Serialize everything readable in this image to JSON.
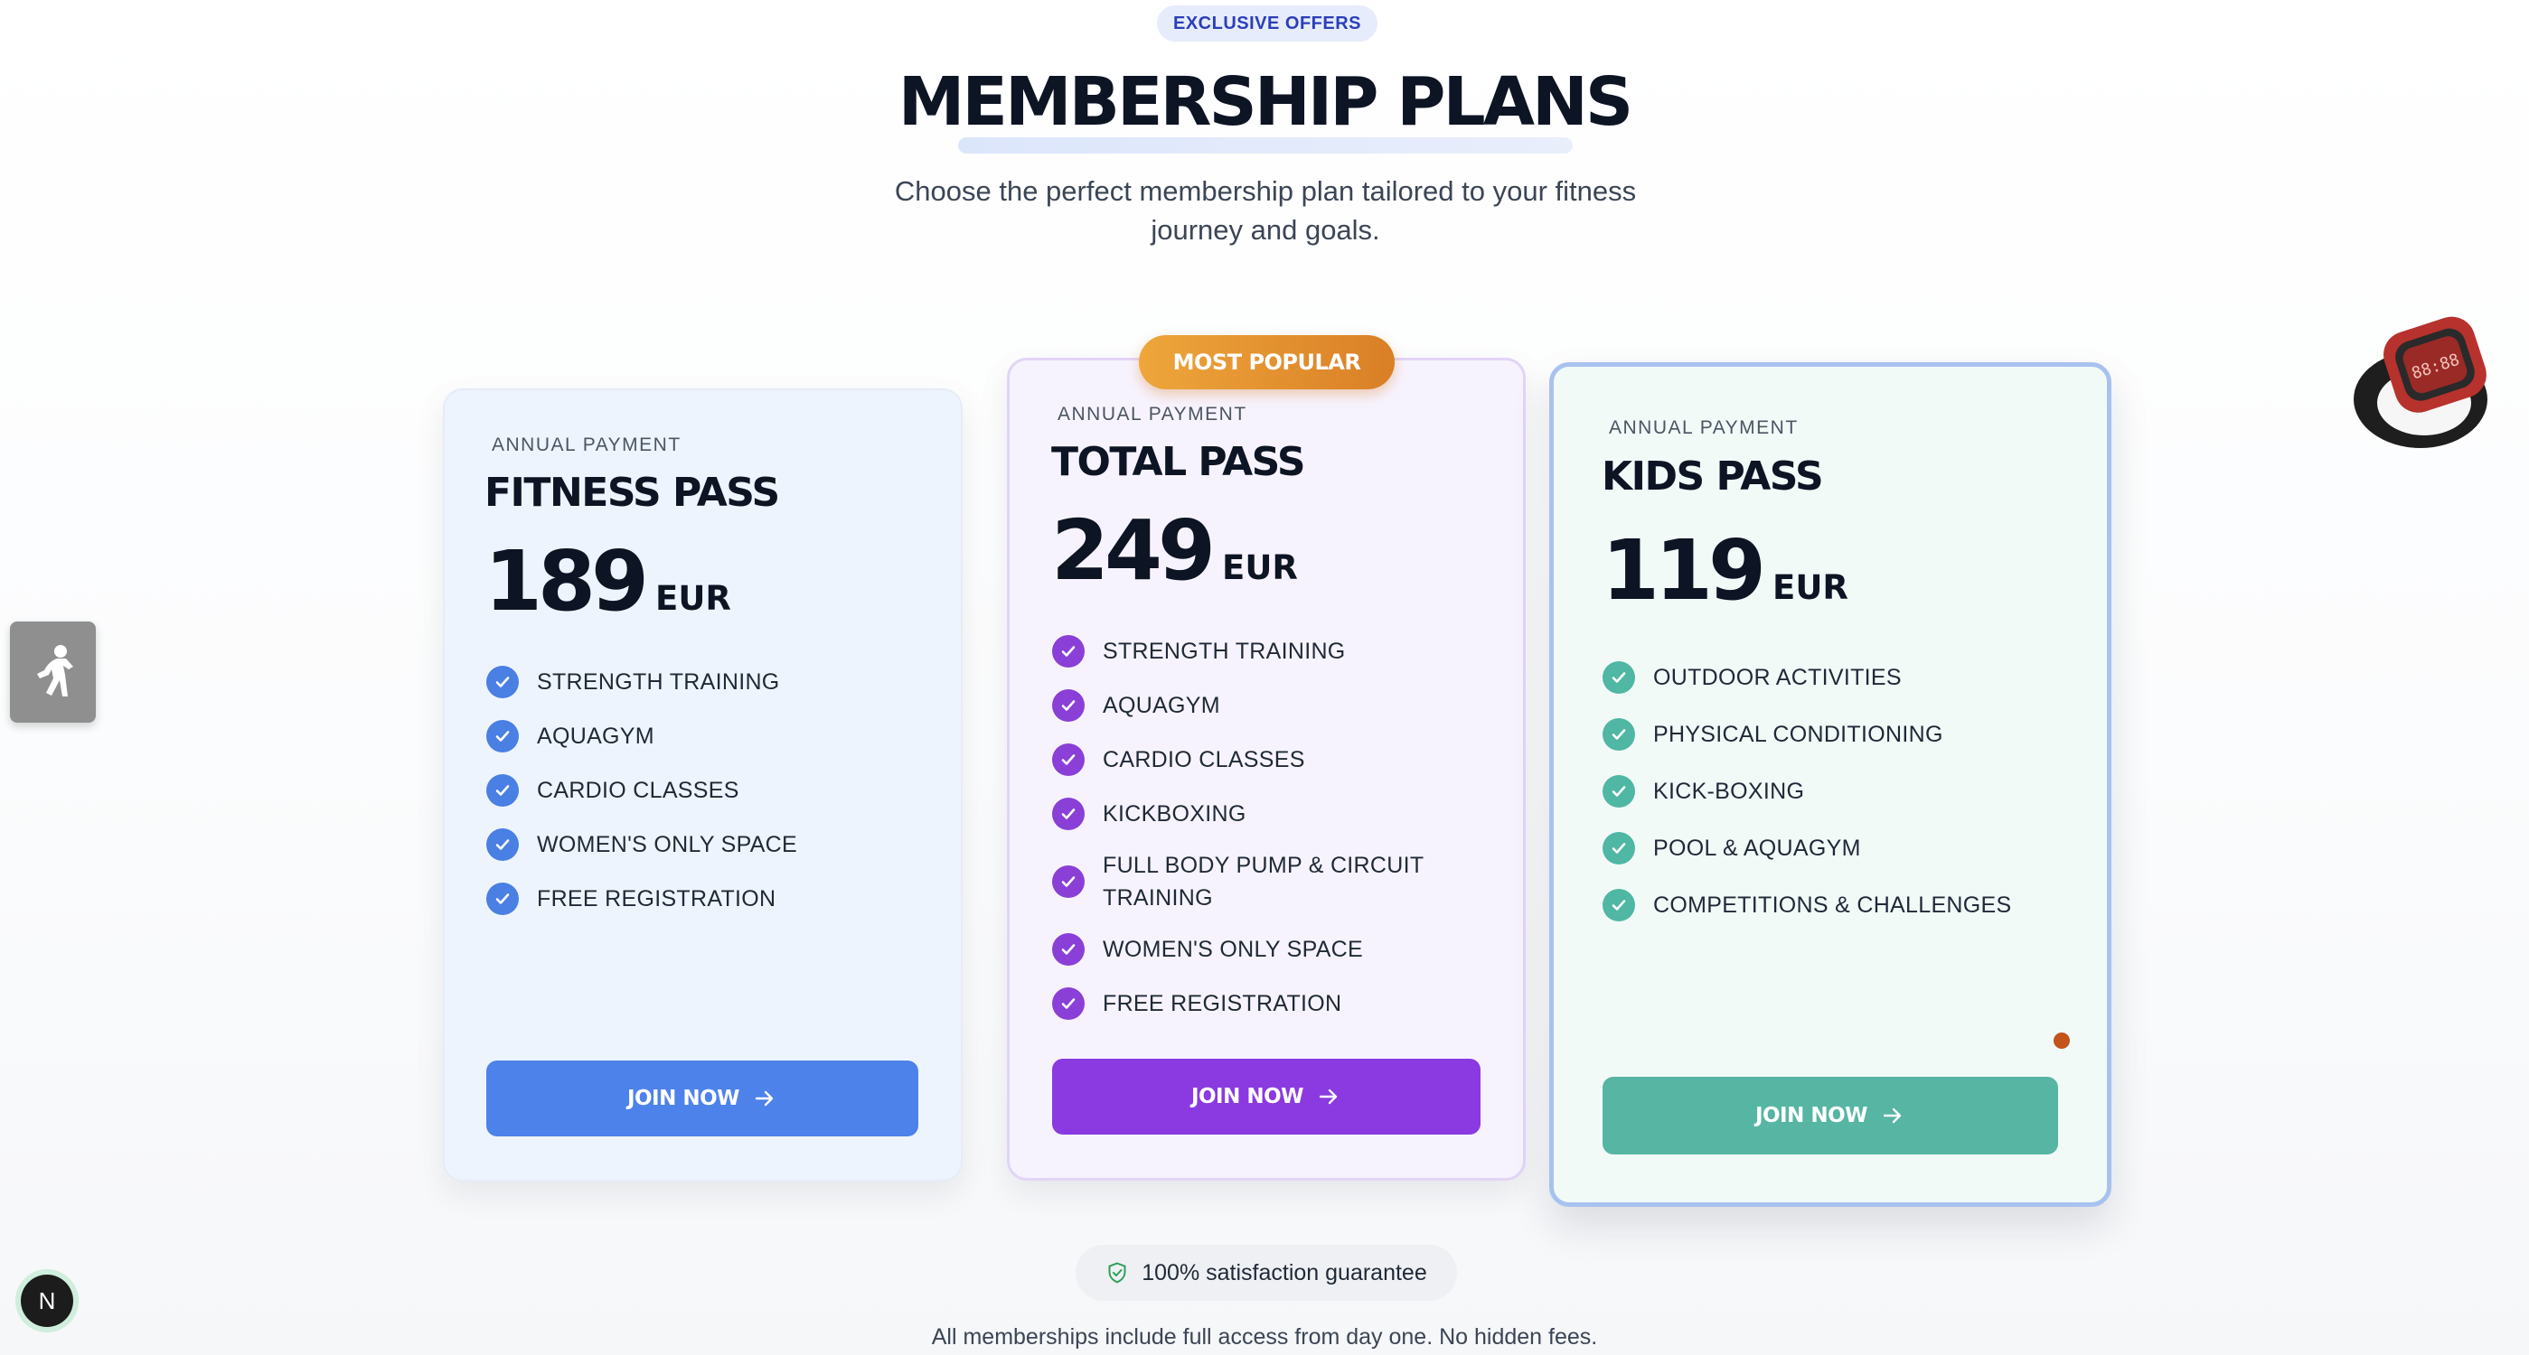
{
  "header": {
    "badge": "EXCLUSIVE OFFERS",
    "title": "MEMBERSHIP PLANS",
    "subtitle": "Choose the perfect membership plan tailored to your fitness journey and goals."
  },
  "plans": [
    {
      "kicker": "ANNUAL PAYMENT",
      "name": "FITNESS PASS",
      "price": "189",
      "currency": "EUR",
      "accent": "#4a7fe3",
      "features": [
        "STRENGTH TRAINING",
        "AQUAGYM",
        "CARDIO CLASSES",
        "WOMEN'S ONLY SPACE",
        "FREE REGISTRATION"
      ],
      "cta": "JOIN NOW"
    },
    {
      "badge": "MOST POPULAR",
      "kicker": "ANNUAL PAYMENT",
      "name": "TOTAL PASS",
      "price": "249",
      "currency": "EUR",
      "accent": "#8a3fd7",
      "features": [
        "STRENGTH TRAINING",
        "AQUAGYM",
        "CARDIO CLASSES",
        "KICKBOXING",
        "FULL BODY PUMP & CIRCUIT TRAINING",
        "WOMEN'S ONLY SPACE",
        "FREE REGISTRATION"
      ],
      "cta": "JOIN NOW"
    },
    {
      "kicker": "ANNUAL PAYMENT",
      "name": "KIDS PASS",
      "price": "119",
      "currency": "EUR",
      "accent": "#4fb7a3",
      "features": [
        "OUTDOOR ACTIVITIES",
        "PHYSICAL CONDITIONING",
        "KICK-BOXING",
        "POOL & AQUAGYM",
        "COMPETITIONS & CHALLENGES"
      ],
      "cta": "JOIN NOW"
    }
  ],
  "footer": {
    "guarantee": "100% satisfaction guarantee",
    "note": "All memberships include full access from day one. No hidden fees."
  },
  "floating": {
    "dev_badge": "N"
  },
  "icons": {
    "check": "check-icon",
    "arrow": "arrow-right-icon",
    "shield": "shield-check-icon",
    "side_tab": "athlete-icon",
    "watch": "smartwatch-icon"
  }
}
